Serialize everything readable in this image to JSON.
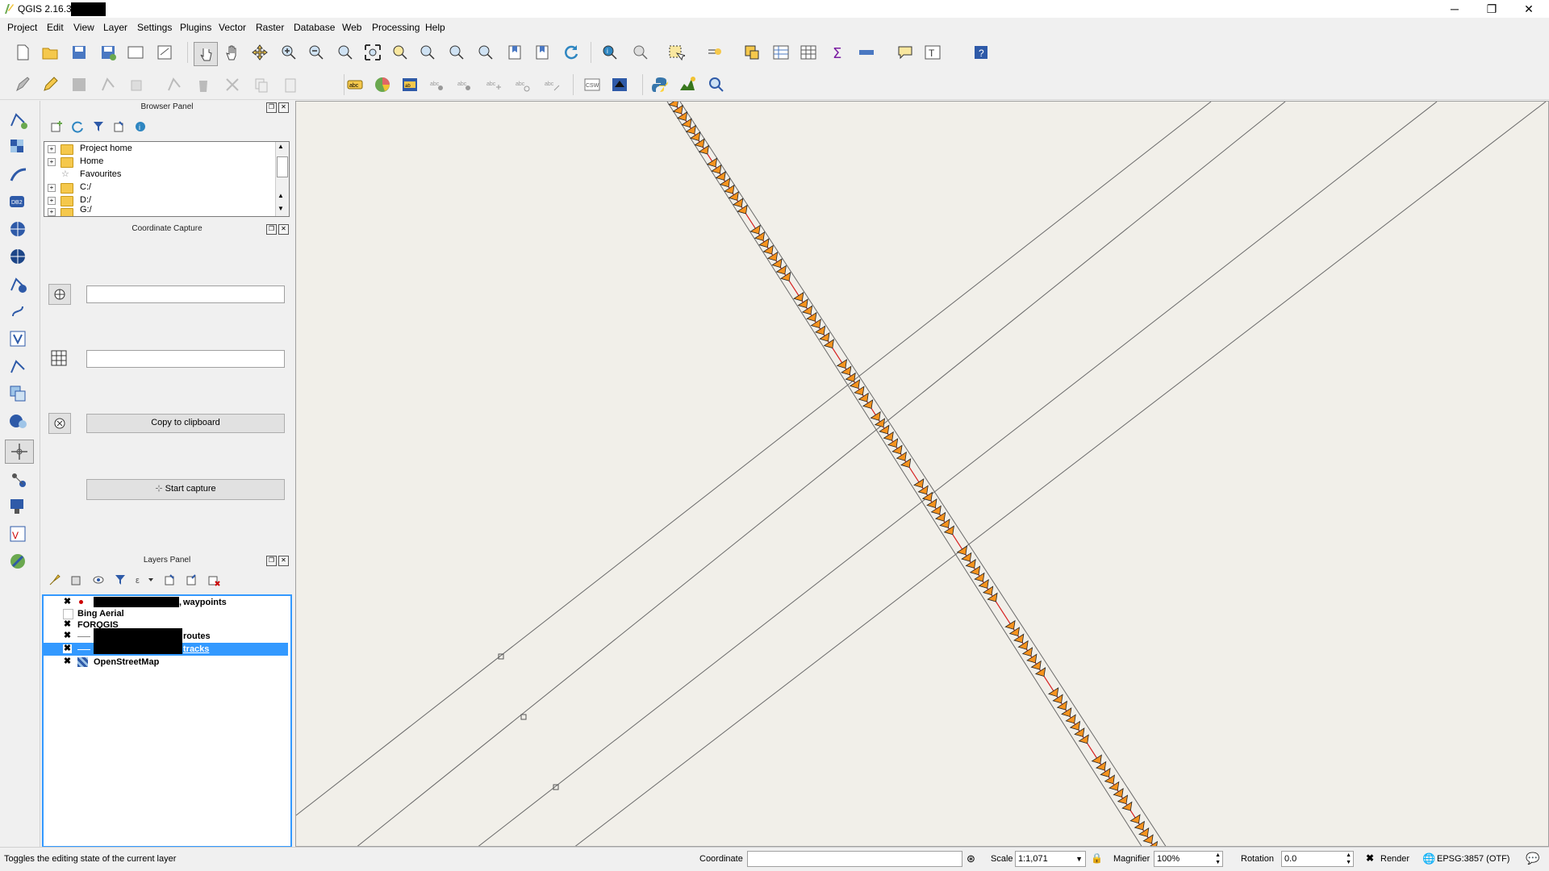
{
  "window": {
    "title": "QGIS 2.16.3 -",
    "controls": {
      "minimize": "─",
      "restore": "❐",
      "close": "✕"
    }
  },
  "menu": [
    "Project",
    "Edit",
    "View",
    "Layer",
    "Settings",
    "Plugins",
    "Vector",
    "Raster",
    "Database",
    "Web",
    "Processing",
    "Help"
  ],
  "browser_panel": {
    "title": "Browser Panel",
    "items": [
      {
        "label": "Project home",
        "icon": "folder-icon"
      },
      {
        "label": "Home",
        "icon": "folder-icon"
      },
      {
        "label": "Favourites",
        "icon": "star-icon"
      },
      {
        "label": "C:/",
        "icon": "folder-icon"
      },
      {
        "label": "D:/",
        "icon": "folder-icon"
      },
      {
        "label": "G:/",
        "icon": "folder-icon"
      }
    ]
  },
  "coordinate_capture": {
    "title": "Coordinate Capture",
    "field1_value": "",
    "field2_value": "",
    "copy_label": "Copy to clipboard",
    "start_label": "Start capture"
  },
  "layers_panel": {
    "title": "Layers Panel",
    "layers": [
      {
        "name": "waypoints",
        "checked": "✖",
        "prefix": ","
      },
      {
        "name": "Bing Aerial",
        "checked": ""
      },
      {
        "name": "FORQGIS",
        "checked": "✖"
      },
      {
        "name": "routes",
        "checked": "✖"
      },
      {
        "name": "tracks",
        "checked": "✖",
        "selected": true
      },
      {
        "name": "OpenStreetMap",
        "checked": "✖"
      }
    ]
  },
  "status": {
    "message": "Toggles the editing state of the current layer",
    "coordinate_label": "Coordinate",
    "coordinate_value": "",
    "scale_label": "Scale",
    "scale_value": "1:1,071",
    "magnifier_label": "Magnifier",
    "magnifier_value": "100%",
    "rotation_label": "Rotation",
    "rotation_value": "0.0",
    "render_label": "Render",
    "crs_label": "EPSG:3857 (OTF)"
  },
  "colors": {
    "map_bg": "#f1efe9",
    "track_orange": "#f7931e",
    "route_red": "#d62020",
    "selection_blue": "#3399ff"
  }
}
